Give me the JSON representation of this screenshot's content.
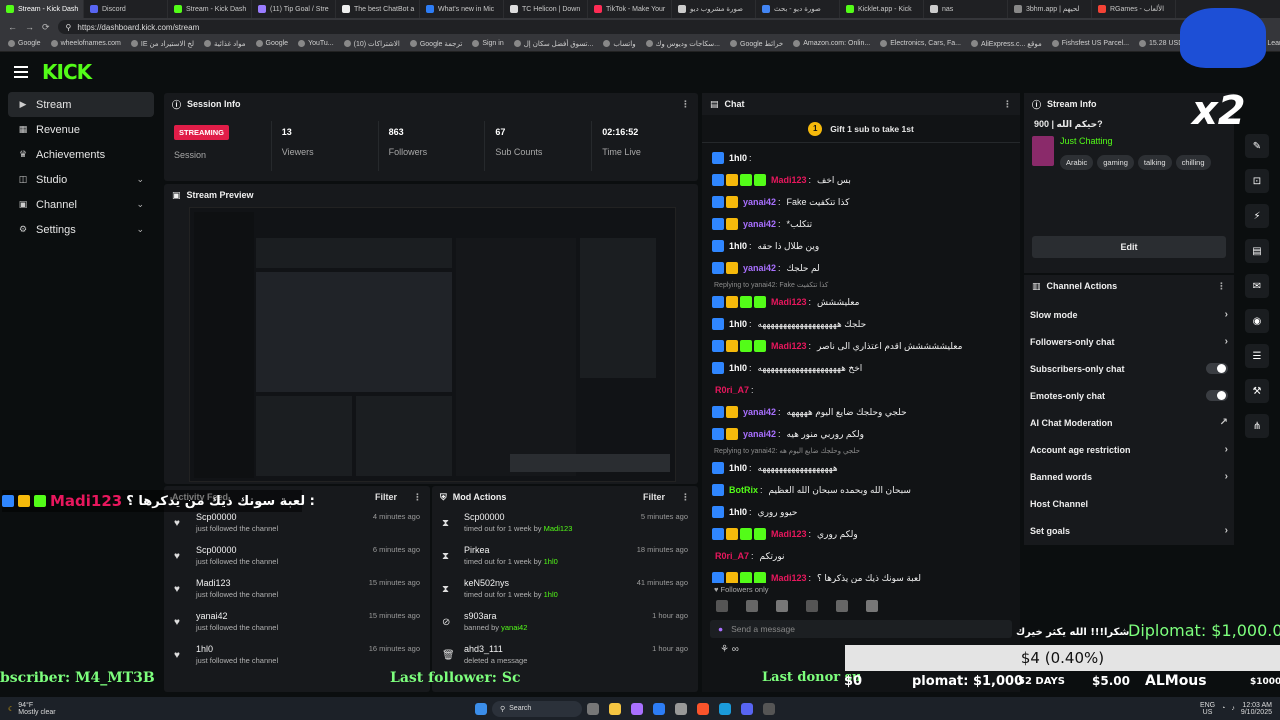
{
  "browser": {
    "tabs": [
      {
        "label": "Stream - Kick Dash",
        "color": "#53fc18",
        "active": true
      },
      {
        "label": "Discord",
        "color": "#5865f2"
      },
      {
        "label": "Stream - Kick Dash",
        "color": "#53fc18"
      },
      {
        "label": "(11) Tip Goal / Stre",
        "color": "#9a7cff"
      },
      {
        "label": "The best ChatBot a",
        "color": "#eeeeee"
      },
      {
        "label": "What's new in Mic",
        "color": "#2d7df6"
      },
      {
        "label": "TC Helicon | Down",
        "color": "#dddddd"
      },
      {
        "label": "TikTok - Make Your",
        "color": "#fe2c55"
      },
      {
        "label": "صورة مشروب ديو",
        "color": "#cccccc"
      },
      {
        "label": "صورة ديو - بحث",
        "color": "#4285f4"
      },
      {
        "label": "Kicklet.app - Kick",
        "color": "#53fc18"
      },
      {
        "label": "nas",
        "color": "#cccccc"
      },
      {
        "label": "3bhm.app | لحيهم",
        "color": "#888888"
      },
      {
        "label": "RGames - الألعاب",
        "color": "#f44336"
      }
    ],
    "url": "https://dashboard.kick.com/stream",
    "bookmarks": [
      "Google",
      "wheelofnames.com",
      "IE لخ الاستيراد من",
      "مواد غذائية",
      "Google",
      "YouTu...",
      "الاشتراكات (10)",
      "Google ترجمة",
      "Sign in",
      "تسوق أفضل سكان إل...",
      "واتساب",
      "سكاجات وديوس وك...",
      "Google خرائط",
      "Amazon.com: Onlin...",
      "Electronics, Cars, Fa...",
      "AliExpress.c... موقع",
      "Fishsfest US Parcel...",
      "15.28 USD to SAR |...",
      "Microsoft Learning"
    ]
  },
  "sidebar": {
    "items": [
      {
        "label": "Stream",
        "icon": "video-icon"
      },
      {
        "label": "Revenue",
        "icon": "wallet-icon"
      },
      {
        "label": "Achievements",
        "icon": "trophy-icon"
      },
      {
        "label": "Studio",
        "icon": "studio-icon"
      },
      {
        "label": "Channel",
        "icon": "channel-icon"
      },
      {
        "label": "Settings",
        "icon": "gear-icon"
      }
    ]
  },
  "session": {
    "title": "Session Info",
    "badge": "STREAMING",
    "badge_label": "Session",
    "stats": [
      {
        "value": "13",
        "label": "Viewers"
      },
      {
        "value": "863",
        "label": "Followers"
      },
      {
        "value": "67",
        "label": "Sub Counts"
      },
      {
        "value": "02:16:52",
        "label": "Time Live"
      }
    ]
  },
  "preview": {
    "title": "Stream Preview"
  },
  "activity": {
    "title": "Activity Feed",
    "filter": "Filter",
    "items": [
      {
        "name": "Scp00000",
        "sub": "just followed the channel",
        "time": "4 minutes ago"
      },
      {
        "name": "Scp00000",
        "sub": "just followed the channel",
        "time": "6 minutes ago"
      },
      {
        "name": "Madi123",
        "sub": "just followed the channel",
        "time": "15 minutes ago"
      },
      {
        "name": "yanai42",
        "sub": "just followed the channel",
        "time": "15 minutes ago"
      },
      {
        "name": "1hl0",
        "sub": "just followed the channel",
        "time": "16 minutes ago"
      }
    ]
  },
  "mod": {
    "title": "Mod Actions",
    "filter": "Filter",
    "items": [
      {
        "name": "Scp00000",
        "pre": "timed out for 1 week by ",
        "by": "Madi123",
        "time": "5 minutes ago",
        "icon": "hourglass-icon"
      },
      {
        "name": "Pirkea",
        "pre": "timed out for 1 week by ",
        "by": "1hl0",
        "time": "18 minutes ago",
        "icon": "hourglass-icon"
      },
      {
        "name": "keN502nys",
        "pre": "timed out for 1 week by ",
        "by": "1hl0",
        "time": "41 minutes ago",
        "icon": "hourglass-icon"
      },
      {
        "name": "s903ara",
        "pre": "banned by ",
        "by": "yanai42",
        "time": "1 hour ago",
        "icon": "ban-icon"
      },
      {
        "name": "ahd3_111",
        "pre": "deleted a message",
        "by": "",
        "time": "1 hour ago",
        "icon": "trash-icon"
      }
    ]
  },
  "chat": {
    "title": "Chat",
    "gift": "Gift 1 sub to take 1st",
    "gift_count": "1",
    "followers_only": "Followers only",
    "input_placeholder": "Send a message",
    "messages": [
      {
        "user": "1hl0",
        "color": "#ffffff",
        "text": "",
        "badges": 1
      },
      {
        "user": "Madi123",
        "color": "#e8175d",
        "text": "بس اخف",
        "badges": 4
      },
      {
        "user": "yanai42",
        "color": "#a970ff",
        "text": "Fake كذا تتكفيت",
        "badges": 2
      },
      {
        "user": "yanai42",
        "color": "#a970ff",
        "text": "*تتكلب",
        "badges": 2
      },
      {
        "user": "1hl0",
        "color": "#ffffff",
        "text": "وين طلال ذا حقه",
        "badges": 1
      },
      {
        "user": "yanai42",
        "color": "#a970ff",
        "text": "لم حلجك",
        "badges": 2
      },
      {
        "reply": "Replying to yanai42: Fake كذا تتكفيت"
      },
      {
        "user": "Madi123",
        "color": "#e8175d",
        "text": "معليششش",
        "badges": 4
      },
      {
        "user": "1hl0",
        "color": "#ffffff",
        "text": "حلجك هههههههههههههههههههه",
        "badges": 1
      },
      {
        "user": "Madi123",
        "color": "#e8175d",
        "text": "معليششششش اقدم اعتذاري الى ناصر",
        "badges": 4
      },
      {
        "user": "1hl0",
        "color": "#ffffff",
        "text": "اخخ ههههههههههههههههههههه",
        "badges": 1
      },
      {
        "user": "R0ri_A7",
        "color": "#e8175d",
        "text": "",
        "badges": 0
      },
      {
        "user": "yanai42",
        "color": "#a970ff",
        "text": "حلجي وحلجك ضايع اليوم هههههه",
        "badges": 2
      },
      {
        "user": "yanai42",
        "color": "#a970ff",
        "text": "ولكم روربي منور هيه",
        "badges": 2
      },
      {
        "reply": "Replying to yanai42: حلجي وحلجك ضايع اليوم هه"
      },
      {
        "user": "1hl0",
        "color": "#ffffff",
        "text": "ههههههههههههههههههه",
        "badges": 1
      },
      {
        "user": "BotRix",
        "color": "#53fc18",
        "text": "سبحان الله وبحمده سبحان الله العظيم",
        "badges": 1
      },
      {
        "user": "1hl0",
        "color": "#ffffff",
        "text": "حيوو روري",
        "badges": 1
      },
      {
        "user": "Madi123",
        "color": "#e8175d",
        "text": "ولكم روري",
        "badges": 4
      },
      {
        "user": "R0ri_A7",
        "color": "#e8175d",
        "text": "نورتكم",
        "badges": 0
      },
      {
        "user": "Madi123",
        "color": "#e8175d",
        "text": "لعبة سونك ذيك من يذكرها ؟",
        "badges": 4
      }
    ]
  },
  "stream_info": {
    "title": "Stream Info",
    "stream_title": "حيكم الله | 900?",
    "category": "Just Chatting",
    "tags": [
      "Arabic",
      "gaming",
      "talking",
      "chilling"
    ],
    "edit": "Edit"
  },
  "channel_actions": {
    "title": "Channel Actions",
    "items": [
      {
        "label": "Slow mode",
        "kind": "arrow"
      },
      {
        "label": "Followers-only chat",
        "kind": "arrow"
      },
      {
        "label": "Subscribers-only chat",
        "kind": "toggle"
      },
      {
        "label": "Emotes-only chat",
        "kind": "toggle"
      },
      {
        "label": "AI Chat Moderation",
        "kind": "link"
      },
      {
        "label": "Account age restriction",
        "kind": "arrow"
      },
      {
        "label": "Banned words",
        "kind": "arrow"
      },
      {
        "label": "Host Channel",
        "kind": "none"
      },
      {
        "label": "Set goals",
        "kind": "arrow"
      }
    ]
  },
  "overlay": {
    "x2": "x2",
    "sonic_question": "لعبة سونك ذيك من يذكرها ؟ :",
    "sonic_user": "Madi123",
    "diplomat": "Diplomat: $1,000.00",
    "thanks": "شكرا!!! الله يكثر خيرك",
    "goal": "$4 (0.40%)",
    "subscriber": "bscriber: M4_MT3B",
    "last_follower": "Last follower: Sc",
    "last_donor": "Last donor su",
    "plomat": "plomat: $1,000",
    "days": "52 DAYS",
    "price": "$5.00",
    "almous": "ALMous",
    "zero": "$0",
    "thousand": "$1000"
  },
  "taskbar": {
    "weather_temp": "94°F",
    "weather_desc": "Mostly clear",
    "search": "Search",
    "lang": "ENG",
    "region": "US",
    "time": "12:03 AM",
    "date": "9/10/2025"
  }
}
